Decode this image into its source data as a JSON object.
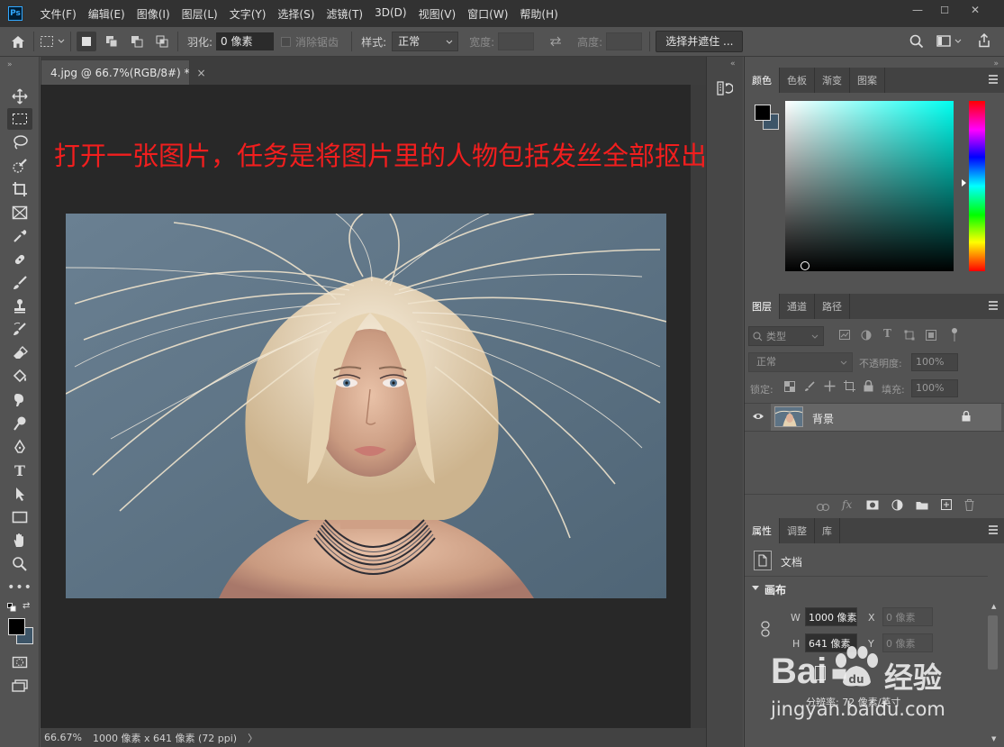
{
  "app": {
    "logo": "Ps"
  },
  "menubar": {
    "items": [
      "文件(F)",
      "编辑(E)",
      "图像(I)",
      "图层(L)",
      "文字(Y)",
      "选择(S)",
      "滤镜(T)",
      "3D(D)",
      "视图(V)",
      "窗口(W)",
      "帮助(H)"
    ]
  },
  "window_controls": {
    "minimize": "—",
    "maximize": "☐",
    "close": "✕"
  },
  "options": {
    "feather_label": "羽化:",
    "feather_value": "0 像素",
    "antialias_label": "消除锯齿",
    "style_label": "样式:",
    "style_value": "正常",
    "width_label": "宽度:",
    "height_label": "高度:",
    "select_mask_button": "选择并遮住 ..."
  },
  "document": {
    "tab_title": "4.jpg @ 66.7%(RGB/8#) *",
    "tab_close": "×",
    "annotation": "打开一张图片，任务是将图片里的人物包括发丝全部抠出来"
  },
  "status": {
    "zoom": "66.67%",
    "doc_info": "1000 像素 x 641 像素 (72 ppi)",
    "arrow": "〉"
  },
  "color_panel": {
    "tabs": [
      "颜色",
      "色板",
      "渐变",
      "图案"
    ]
  },
  "layers_panel": {
    "tabs": [
      "图层",
      "通道",
      "路径"
    ],
    "filter_placeholder": "类型",
    "blend_mode": "正常",
    "opacity_label": "不透明度:",
    "opacity_value": "100%",
    "lock_label": "锁定:",
    "fill_label": "填充:",
    "fill_value": "100%",
    "layers": [
      {
        "name": "背景",
        "visible": true,
        "locked": true
      }
    ]
  },
  "properties_panel": {
    "tabs": [
      "属性",
      "调整",
      "库"
    ],
    "type_label": "文档",
    "section_title": "画布",
    "w_label": "W",
    "w_value": "1000 像素",
    "h_label": "H",
    "h_value": "641 像素",
    "x_label": "X",
    "x_value": "0 像素",
    "y_label": "Y",
    "y_value": "0 像素",
    "resolution": "分辨率: 72 像素/英寸"
  },
  "watermark": {
    "brand": "Bai",
    "brand2": "经验",
    "url": "jingyan.baidu.com"
  },
  "colors": {
    "annotation": "#f21e1e",
    "accent": "#31a8ff",
    "foreground": "#000000",
    "background_swatch": "#3d5568"
  }
}
